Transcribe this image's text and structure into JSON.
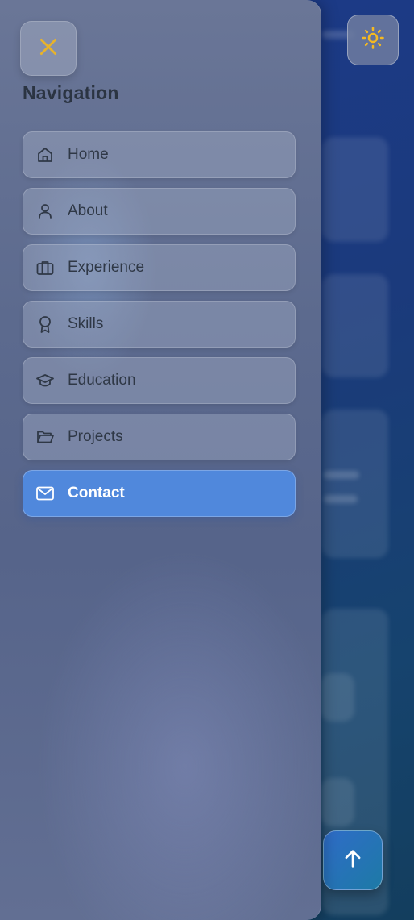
{
  "drawer": {
    "title": "Navigation",
    "close_icon": "close-icon",
    "items": [
      {
        "label": "Home",
        "icon": "home-icon",
        "active": false
      },
      {
        "label": "About",
        "icon": "user-icon",
        "active": false
      },
      {
        "label": "Experience",
        "icon": "briefcase-icon",
        "active": false
      },
      {
        "label": "Skills",
        "icon": "award-icon",
        "active": false
      },
      {
        "label": "Education",
        "icon": "graduation-cap-icon",
        "active": false
      },
      {
        "label": "Projects",
        "icon": "folder-icon",
        "active": false
      },
      {
        "label": "Contact",
        "icon": "mail-icon",
        "active": true
      }
    ]
  },
  "header": {
    "theme_toggle_icon": "sun-icon"
  },
  "scroll_top": {
    "icon": "arrow-up-icon"
  },
  "colors": {
    "accent": "#5088dc",
    "close_icon": "#e8b32a",
    "sun_icon": "#f5b921"
  }
}
